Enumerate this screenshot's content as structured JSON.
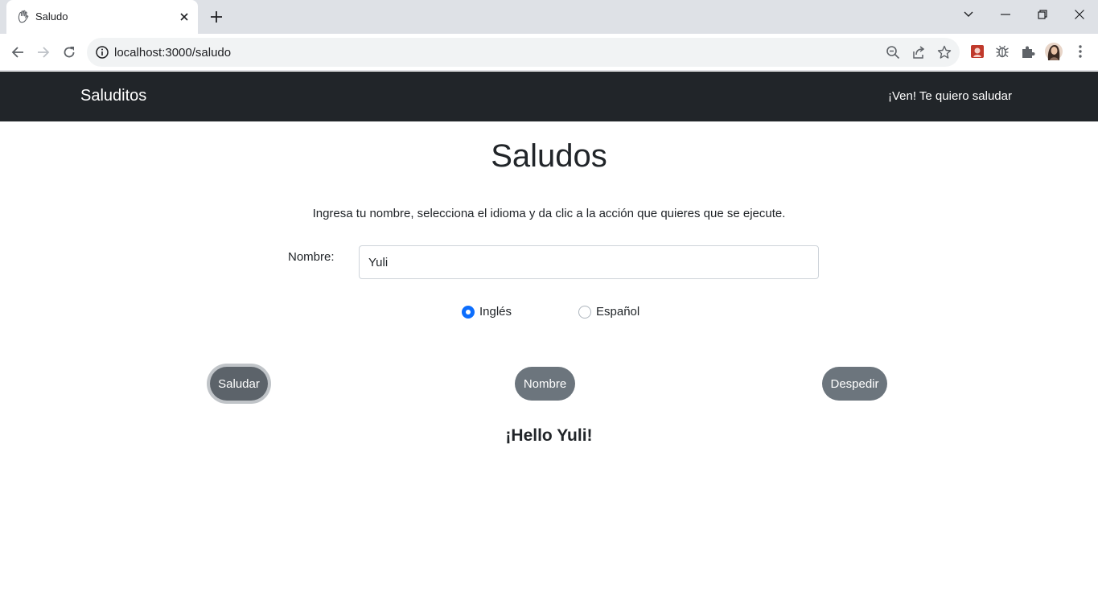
{
  "browser": {
    "tab_title": "Saludo",
    "url": "localhost:3000/saludo",
    "icons": {
      "favicon": "waving-hand-icon",
      "close": "close-icon",
      "new_tab": "plus-icon",
      "tab_search": "chevron-down-icon",
      "minimize": "minimize-icon",
      "restore": "restore-icon",
      "window_close": "close-icon",
      "back": "arrow-left-icon",
      "forward": "arrow-right-icon",
      "reload": "reload-icon",
      "site_info": "info-icon",
      "zoom": "zoom-out-icon",
      "share": "share-icon",
      "bookmark": "star-icon",
      "extensions": "puzzle-icon",
      "menu": "kebab-menu-icon"
    }
  },
  "navbar": {
    "brand": "Saluditos",
    "link": "¡Ven! Te quiero saludar",
    "background": "#212529"
  },
  "main": {
    "title": "Saludos",
    "instructions": "Ingresa tu nombre, selecciona el idioma y da clic a la acción que quieres que se ejecute.",
    "name_label": "Nombre:",
    "name_value": "Yuli",
    "languages": [
      {
        "label": "Inglés",
        "checked": true
      },
      {
        "label": "Español",
        "checked": false
      }
    ],
    "buttons": {
      "greet": "Saludar",
      "name": "Nombre",
      "farewell": "Despedir"
    },
    "result": "¡Hello Yuli!"
  },
  "colors": {
    "button": "#6c757d",
    "radio_checked": "#0d6efd"
  }
}
